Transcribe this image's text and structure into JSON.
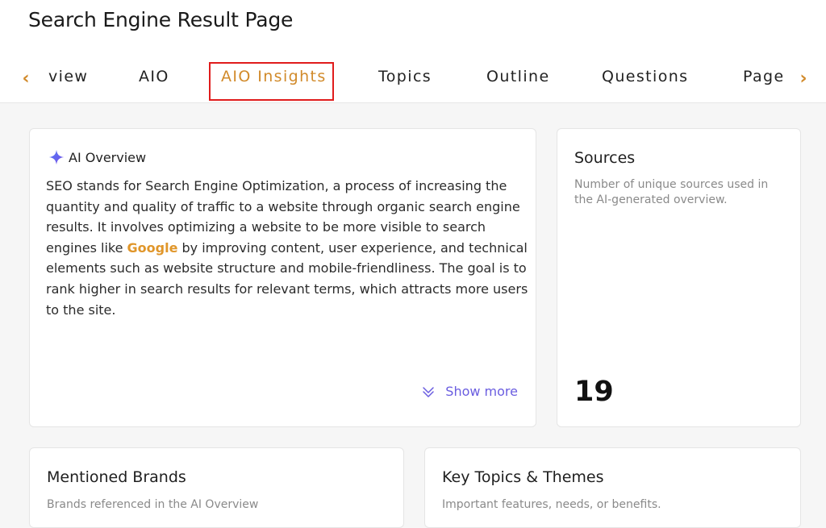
{
  "page": {
    "title": "Search Engine Result Page"
  },
  "tabs": {
    "prev_icon": "chevron-left-icon",
    "next_icon": "chevron-right-icon",
    "items": [
      {
        "label": "view",
        "active": false
      },
      {
        "label": "AIO",
        "active": false
      },
      {
        "label": "AIO Insights",
        "active": true
      },
      {
        "label": "Topics",
        "active": false
      },
      {
        "label": "Outline",
        "active": false
      },
      {
        "label": "Questions",
        "active": false
      },
      {
        "label": "Page",
        "active": false
      }
    ],
    "accent": "#d18a2a",
    "highlight_box_color": "#e01c1c"
  },
  "ai_overview": {
    "icon": "sparkle-icon",
    "title": "AI Overview",
    "text_before": "SEO stands for Search Engine Optimization, a process of increasing the quantity and quality of traffic to a website through organic search engine results. It involves optimizing a website to be more visible to search engines like ",
    "highlight": "Google",
    "text_after": " by improving content, user experience, and technical elements such as website structure and mobile-friendliness. The goal is to rank higher in search results for relevant terms, which attracts more users to the site.",
    "show_more_label": "Show more",
    "show_more_icon": "double-chevron-down-icon",
    "link_color": "#6a5de0"
  },
  "sources": {
    "title": "Sources",
    "description": "Number of unique sources used in the AI-generated overview.",
    "count": "19"
  },
  "brands": {
    "title": "Mentioned Brands",
    "description": "Brands referenced in the AI Overview"
  },
  "topics": {
    "title": "Key Topics & Themes",
    "description": "Important features, needs, or benefits."
  }
}
